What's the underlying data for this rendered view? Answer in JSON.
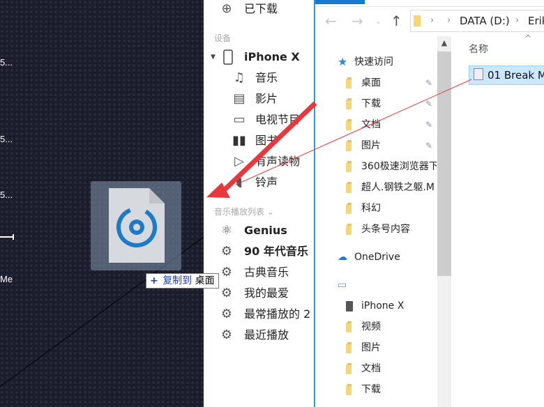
{
  "desktop": {
    "labels": [
      "5...",
      "5...",
      "5...",
      "Me"
    ],
    "drag_tooltip": {
      "action": "复制到",
      "target": "桌面",
      "plus": "+"
    }
  },
  "itunes_sidebar": {
    "downloaded": "已下载",
    "devices_header": "设备",
    "device_name": "iPhone X",
    "device_items": [
      {
        "label": "音乐",
        "icon": "music-note-icon"
      },
      {
        "label": "影片",
        "icon": "film-icon"
      },
      {
        "label": "电视节目",
        "icon": "tv-icon"
      },
      {
        "label": "图书",
        "icon": "book-icon"
      },
      {
        "label": "有声读物",
        "icon": "audiobook-icon"
      },
      {
        "label": "铃声",
        "icon": "bell-icon"
      }
    ],
    "playlists_header": "音乐播放列表",
    "playlists": [
      {
        "label": "Genius",
        "icon": "genius-atom-icon"
      },
      {
        "label": "90 年代音乐",
        "icon": "smart-playlist-gear-icon"
      },
      {
        "label": "古典音乐",
        "icon": "smart-playlist-gear-icon"
      },
      {
        "label": "我的最爱",
        "icon": "smart-playlist-gear-icon"
      },
      {
        "label": "最常播放的 2",
        "icon": "smart-playlist-gear-icon"
      },
      {
        "label": "最近播放",
        "icon": "smart-playlist-gear-icon"
      }
    ]
  },
  "explorer": {
    "address": {
      "crumbs": [
        "DATA (D:)",
        "Erik"
      ]
    },
    "quick_access": "快速访问",
    "quick_items": [
      {
        "label": "桌面",
        "pinned": true
      },
      {
        "label": "下载",
        "pinned": true
      },
      {
        "label": "文档",
        "pinned": true
      },
      {
        "label": "图片",
        "pinned": true
      },
      {
        "label": "360极速浏览器下",
        "pinned": false
      },
      {
        "label": "超人.钢铁之躯.M",
        "pinned": false
      },
      {
        "label": "科幻",
        "pinned": false
      },
      {
        "label": "头条号内容",
        "pinned": false
      }
    ],
    "onedrive": "OneDrive",
    "this_pc": "",
    "pc_items": [
      {
        "label": "iPhone X"
      },
      {
        "label": "视频"
      },
      {
        "label": "图片"
      },
      {
        "label": "文档"
      },
      {
        "label": "下载"
      }
    ],
    "column_header": "名称",
    "selected_file": "01 Break M"
  },
  "colors": {
    "accent": "#1a78d0",
    "arrow": "#e8383d",
    "selection": "#cce8ff"
  }
}
